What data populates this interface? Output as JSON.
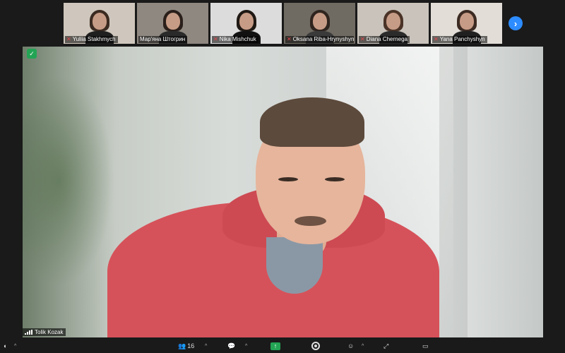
{
  "gallery": {
    "participants": [
      {
        "name": "Yuliia Stakhmych",
        "mic": "muted",
        "bg": "#cfc7bd",
        "hair": "#3b2a20",
        "body": "#1f1f1f"
      },
      {
        "name": "Мар'яна Штогрин",
        "mic": "unmuted",
        "bg": "#8f8880",
        "hair": "#2a1f1a",
        "body": "#2a2a2a"
      },
      {
        "name": "Nika Mishchuk",
        "mic": "muted",
        "bg": "#dcdcdc",
        "hair": "#1f1813",
        "body": "#111111"
      },
      {
        "name": "Oksana Riba-Hrynyshyn",
        "mic": "muted",
        "bg": "#6f6a62",
        "hair": "#2f241e",
        "body": "#3a3a3a"
      },
      {
        "name": "Diana Chernega",
        "mic": "muted",
        "bg": "#c9c3bb",
        "hair": "#4a3226",
        "body": "#2b2b2b"
      },
      {
        "name": "Yana Panchyshyn",
        "mic": "muted",
        "bg": "#e2ddd7",
        "hair": "#3c2b22",
        "body": "#202020"
      }
    ],
    "next_icon": "chevron-right-icon",
    "next_glyph": "›"
  },
  "speaker": {
    "name": "Tolik Kozak",
    "signal_icon": "signal-bars-icon",
    "encryption_icon": "shield-check-icon",
    "encryption_glyph": "✓"
  },
  "toolbar": {
    "participants_count": "16",
    "caret_glyph": "^",
    "mute_glyph": "◖",
    "participants_glyph": "👥",
    "chat_glyph": "💬",
    "share_glyph": "↑",
    "reactions_glyph": "☺",
    "apps_glyph": "⤢",
    "view_glyph": "▭"
  },
  "colors": {
    "accent": "#2d8cff",
    "security_green": "#23a455",
    "muted_red": "#e5484d",
    "background": "#1a1a1a"
  }
}
